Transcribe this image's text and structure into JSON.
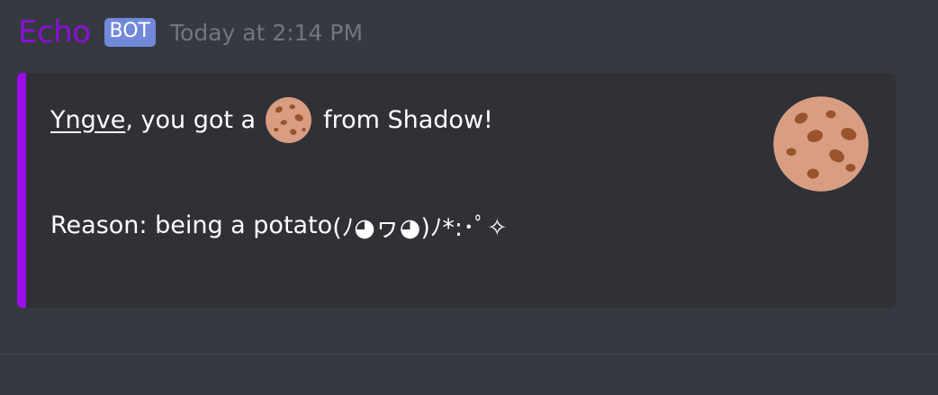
{
  "message": {
    "author": "Echo",
    "bot_tag": "BOT",
    "timestamp": "Today at 2:14 PM",
    "author_color": "#8a0fd8"
  },
  "embed": {
    "accent_color": "#9b0dea",
    "mention": "Yngve",
    "text_before_emoji": ", you got a",
    "emoji": "cookie-icon",
    "text_after_emoji": "from Shadow!",
    "reason_label": "Reason: being a potato",
    "reason_kaomoji": "(ﾉ◕ヮ◕)ﾉ*:･ﾟ✧",
    "thumbnail": "cookie-icon"
  }
}
